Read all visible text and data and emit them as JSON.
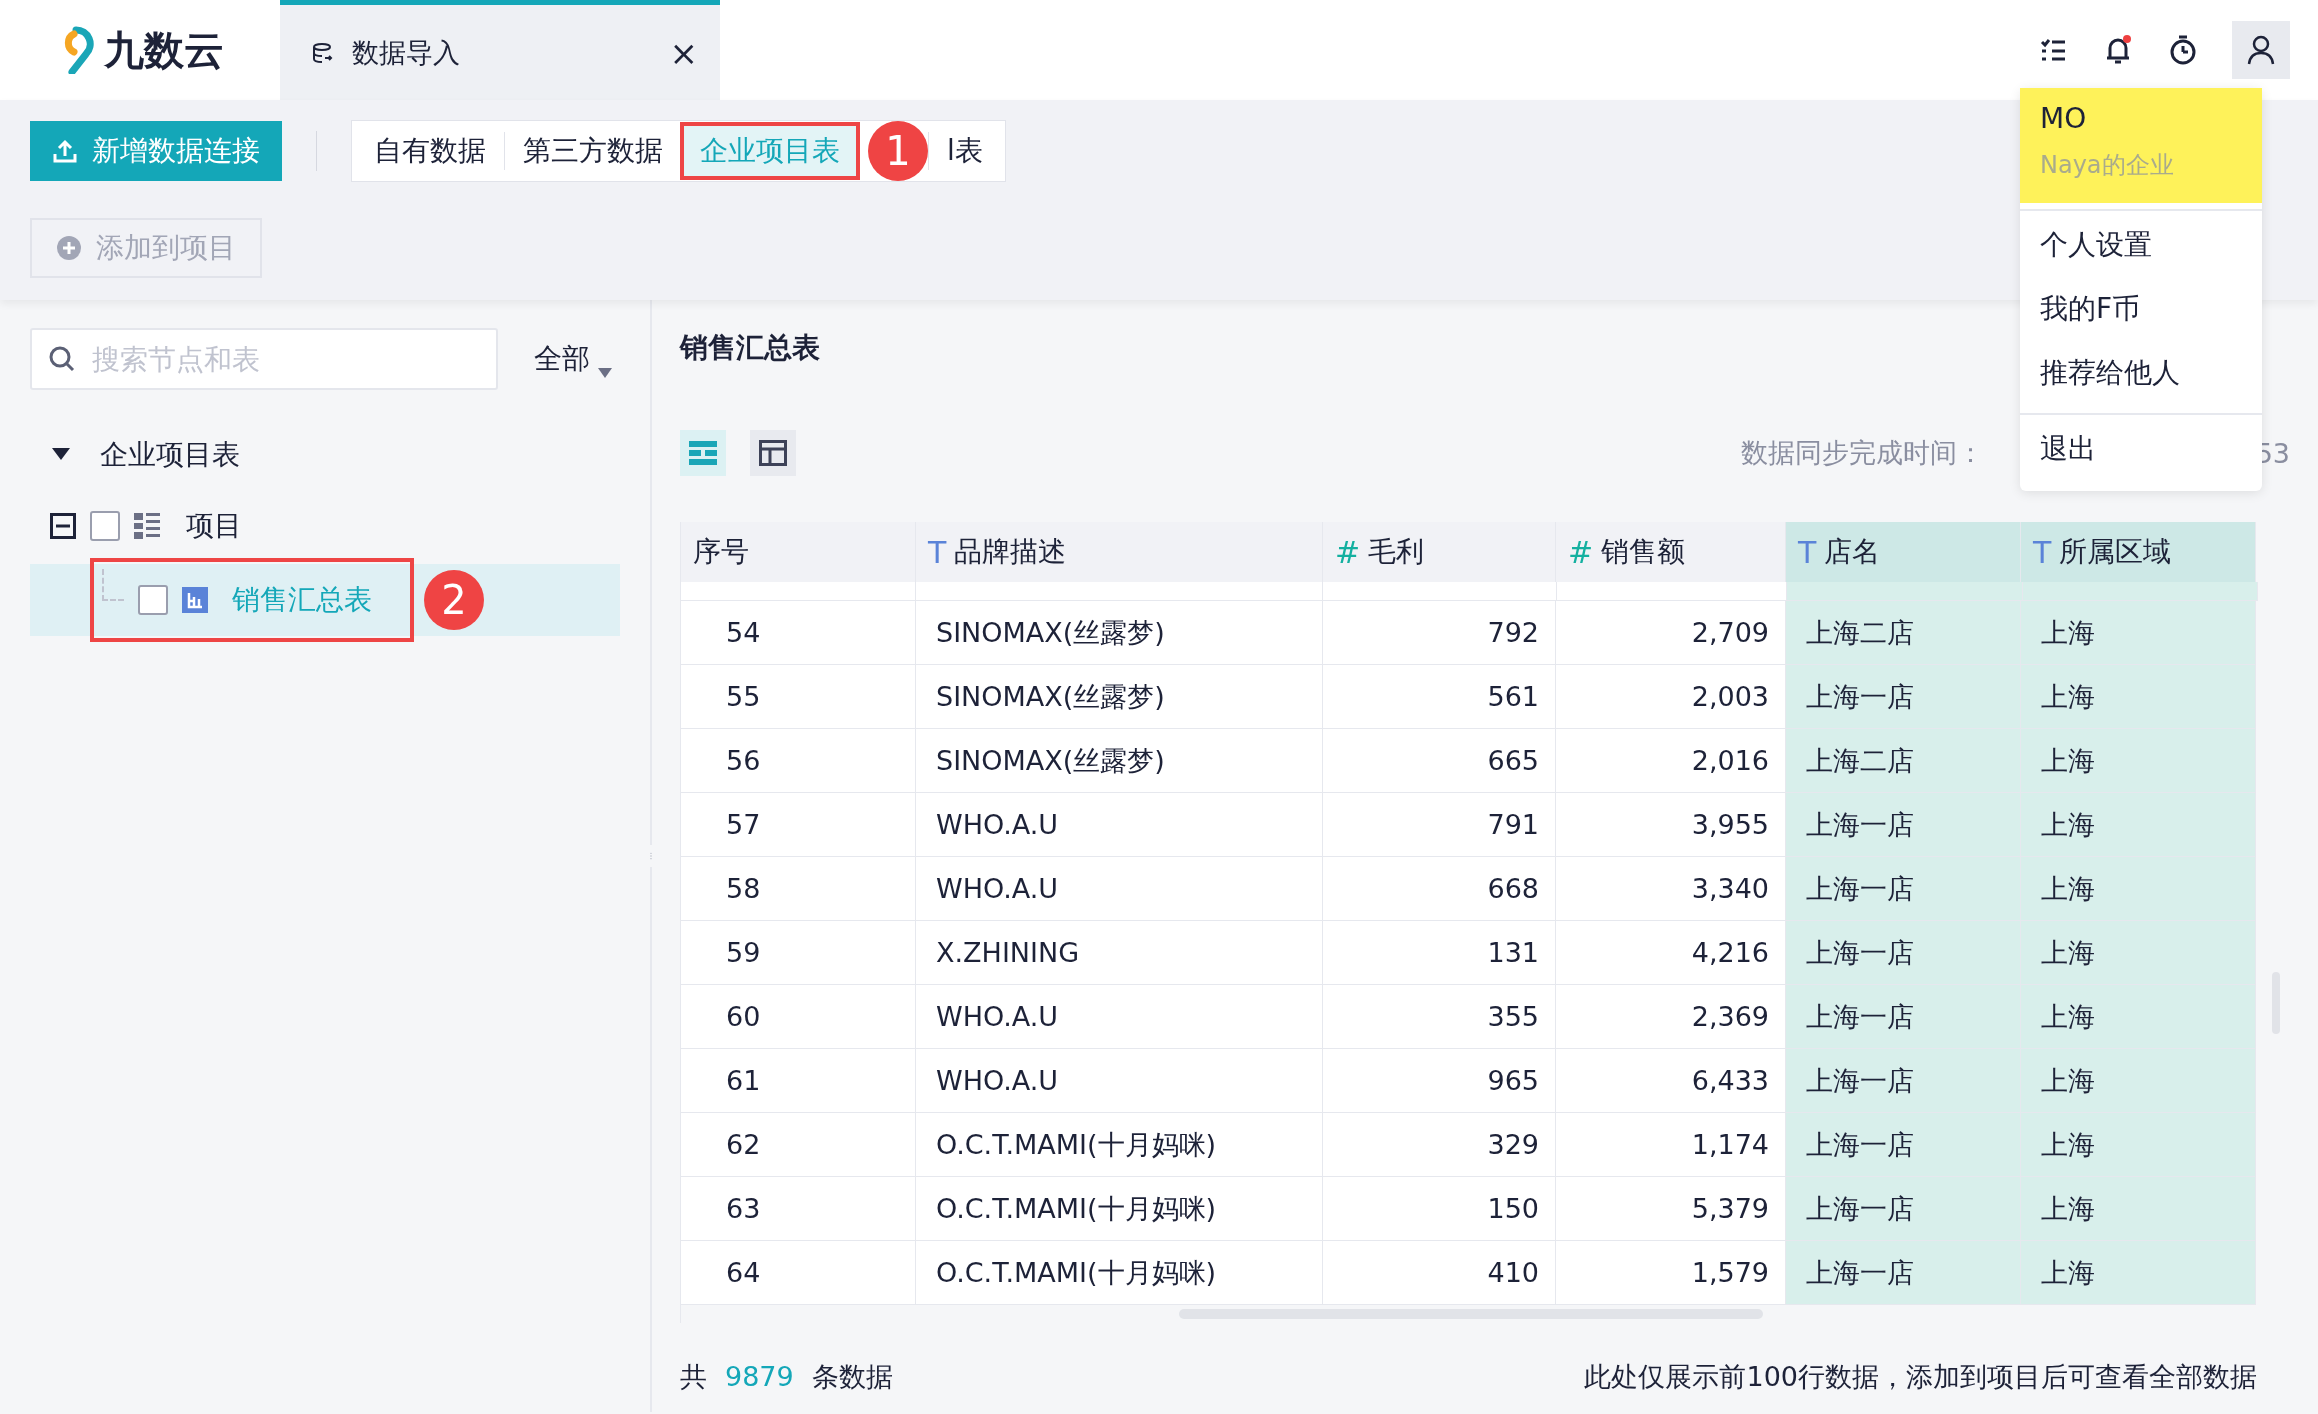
{
  "app": {
    "logo": "九数云"
  },
  "open_tab": {
    "title": "数据导入",
    "close": "×"
  },
  "header_icons": {
    "notifications_unread": true
  },
  "toolbar": {
    "primary_button": "新增数据连接",
    "source_tabs": [
      {
        "label": "自有数据",
        "selected": false
      },
      {
        "label": "第三方数据",
        "selected": false
      },
      {
        "label": "企业项目表",
        "selected": true,
        "callout": "1"
      },
      {
        "label": "l表",
        "selected": false
      }
    ],
    "add_button": {
      "label": "添加到项目",
      "disabled": true
    }
  },
  "sidebar": {
    "search": {
      "placeholder": "搜索节点和表"
    },
    "filter": "全部",
    "tree": [
      {
        "label": "企业项目表",
        "kind": "group",
        "expanded": true,
        "children": [
          {
            "label": "项目",
            "kind": "folder",
            "expanded": true,
            "checked": false,
            "selected": false,
            "children": [
              {
                "label": "销售汇总表",
                "kind": "table",
                "checked": false,
                "selected": true,
                "callout": "2"
              }
            ]
          }
        ]
      }
    ]
  },
  "preview": {
    "title": "销售汇总表",
    "view_toggles": [
      {
        "selected": true
      },
      {
        "selected": false
      }
    ],
    "sync_label": "数据同步完成时间：",
    "sync_value_tail": "53",
    "columns": [
      {
        "label": "序号",
        "kind": "index",
        "highlighted": false
      },
      {
        "icon": "T",
        "label": "品牌描述",
        "kind": "text",
        "highlighted": false
      },
      {
        "icon": "#",
        "label": "毛利",
        "kind": "number",
        "highlighted": false
      },
      {
        "icon": "#",
        "label": "销售额",
        "kind": "number",
        "highlighted": false
      },
      {
        "icon": "T",
        "label": "店名",
        "kind": "text",
        "highlighted": true
      },
      {
        "icon": "T",
        "label": "所属区域",
        "kind": "text",
        "highlighted": true
      }
    ],
    "rows": [
      [
        "54",
        "SINOMAX(丝露梦)",
        "792",
        "2,709",
        "上海二店",
        "上海"
      ],
      [
        "55",
        "SINOMAX(丝露梦)",
        "561",
        "2,003",
        "上海一店",
        "上海"
      ],
      [
        "56",
        "SINOMAX(丝露梦)",
        "665",
        "2,016",
        "上海二店",
        "上海"
      ],
      [
        "57",
        "WHO.A.U",
        "791",
        "3,955",
        "上海一店",
        "上海"
      ],
      [
        "58",
        "WHO.A.U",
        "668",
        "3,340",
        "上海一店",
        "上海"
      ],
      [
        "59",
        "X.ZHINING",
        "131",
        "4,216",
        "上海一店",
        "上海"
      ],
      [
        "60",
        "WHO.A.U",
        "355",
        "2,369",
        "上海一店",
        "上海"
      ],
      [
        "61",
        "WHO.A.U",
        "965",
        "6,433",
        "上海一店",
        "上海"
      ],
      [
        "62",
        "O.C.T.MAMI(十月妈咪)",
        "329",
        "1,174",
        "上海一店",
        "上海"
      ],
      [
        "63",
        "O.C.T.MAMI(十月妈咪)",
        "150",
        "5,379",
        "上海一店",
        "上海"
      ],
      [
        "64",
        "O.C.T.MAMI(十月妈咪)",
        "410",
        "1,579",
        "上海一店",
        "上海"
      ]
    ],
    "total_prefix": "共",
    "total_count": "9879",
    "total_suffix": "条数据",
    "note": "此处仅展示前100行数据，添加到项目后可查看全部数据"
  },
  "user_menu": {
    "name": "MO",
    "org": "Naya的企业",
    "highlighted": true,
    "groups": [
      [
        "个人设置",
        "我的F币",
        "推荐给他人"
      ],
      [
        "退出"
      ]
    ]
  }
}
